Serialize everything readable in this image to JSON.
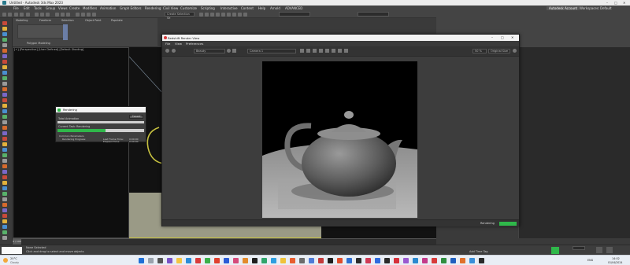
{
  "window": {
    "title": "Untitled - Autodesk 3ds Max 2023"
  },
  "menubar": {
    "items": [
      "File",
      "Edit",
      "Tools",
      "Group",
      "Views",
      "Create",
      "Modifiers",
      "Animation",
      "Graph Editors",
      "Rendering",
      "Civil View",
      "Customize",
      "Scripting",
      "Interactive",
      "Content",
      "Help",
      "Arnold",
      "ADVANCED"
    ]
  },
  "toolbar": {
    "selection_set": "Create Selection Se",
    "workspace_label": "Workspaces:",
    "workspace_value": "Default",
    "user": "Autodesk Account"
  },
  "ribbon": {
    "tabs": [
      "Modeling",
      "Freeform",
      "Selection",
      "Object Paint",
      "Populate"
    ],
    "sub": "Polygon Modeling"
  },
  "viewport": {
    "label": "[+] [Perspective] [User Defined] [Default Shading]"
  },
  "render_window": {
    "title": "Redshift Render View",
    "menu": [
      "File",
      "View",
      "Preferences"
    ],
    "camera": "Beauty",
    "aov": "Camera 1",
    "zoom": "50 %",
    "display": "Original Size",
    "status": "Rendering"
  },
  "render_dialog": {
    "title": "Rendering",
    "cancel": "Cancel",
    "total_label": "Total Animation",
    "current_label": "Current Task:",
    "current_value": "Rendering",
    "common_params": "Common Parameters",
    "progress_label": "Rendering Progress:",
    "frame_label": "Frame #: 0",
    "of_label": "1 of 1",
    "total_time_label": "Total",
    "last_frame_label": "Last Frame Time:",
    "last_frame_value": "0:00:00",
    "elapsed_label": "Elapsed Time:",
    "elapsed_value": "0:00:00",
    "progress_pct": 0.55
  },
  "status": {
    "selection": "None Selected",
    "hint": "Click and drag to select and move objects",
    "add_time_tag": "Add Time Tag",
    "frame": "0 / 100"
  },
  "taskbar": {
    "weather_temp": "20°C",
    "weather_desc": "Cloudy",
    "time": "14:02",
    "date": "01/04/2024",
    "lang": "ENG"
  },
  "colors": {
    "accent_green": "#2fb84a",
    "viewport_bg": "#121212",
    "highlight_yellow": "#c8c240"
  }
}
